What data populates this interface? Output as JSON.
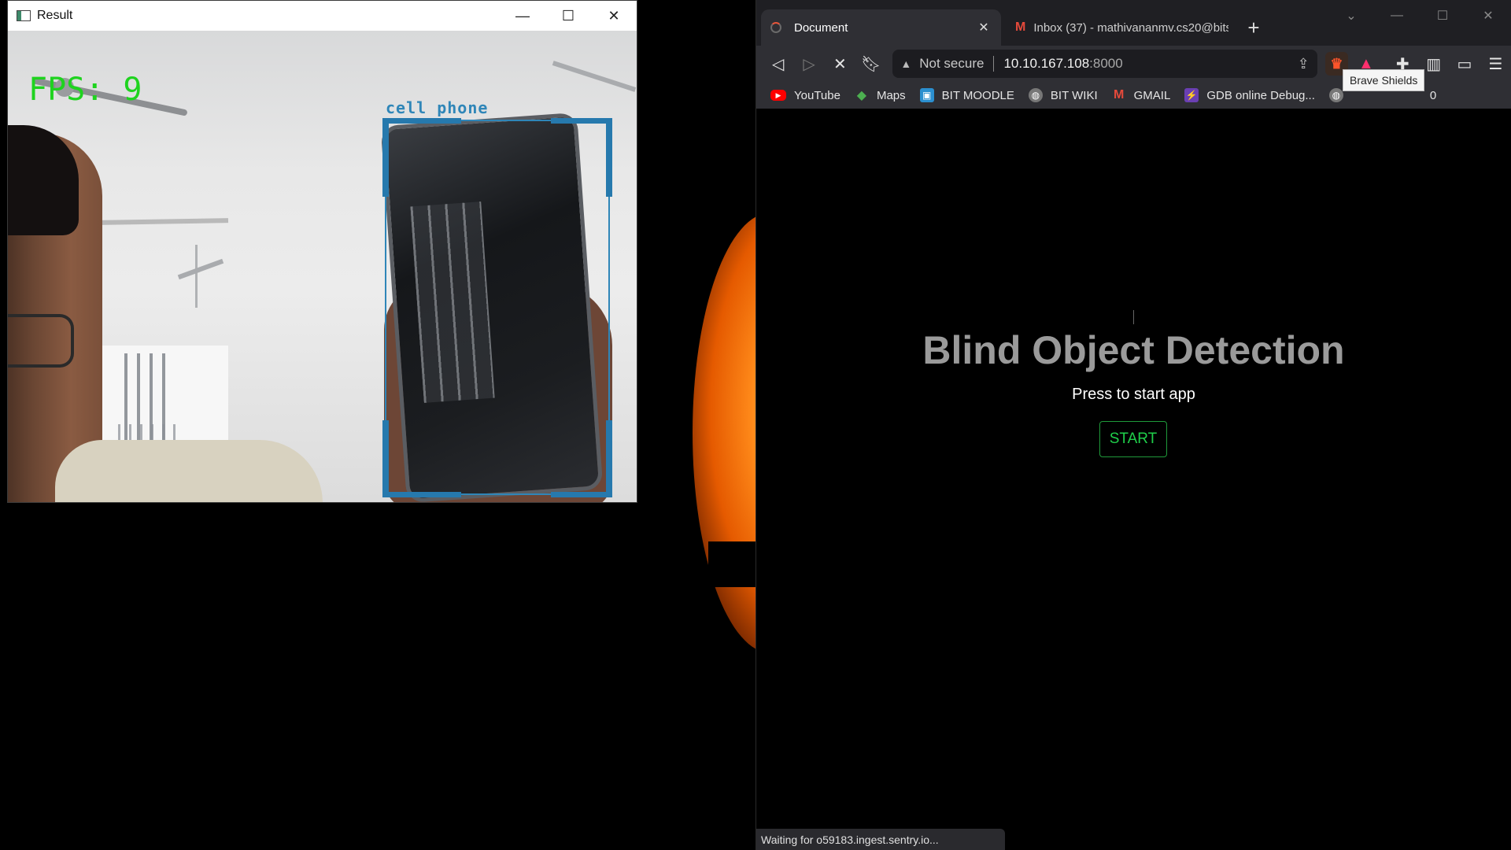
{
  "result_window": {
    "title": "Result",
    "controls": {
      "minimize": "—",
      "maximize": "☐",
      "close": "✕"
    },
    "fps_text": "FPS:  9",
    "detection_label": "cell phone",
    "detection_color": "#2f86b8",
    "fps_color": "#1fd31f"
  },
  "browser": {
    "tabs": [
      {
        "title": "Document",
        "active": true,
        "loading": true
      },
      {
        "title": "Inbox (37) - mathivananmv.cs20@bits",
        "active": false,
        "icon": "gmail-icon"
      }
    ],
    "new_tab": "+",
    "toolbar": {
      "security_text": "Not secure",
      "url_host": "10.10.167.108",
      "url_port": ":8000"
    },
    "tooltip": "Brave Shields",
    "bookmarks": [
      {
        "label": "YouTube",
        "icon": "youtube-icon"
      },
      {
        "label": "Maps",
        "icon": "maps-icon"
      },
      {
        "label": "BIT MOODLE",
        "icon": "moodle-icon"
      },
      {
        "label": "BIT WIKI",
        "icon": "globe-icon"
      },
      {
        "label": "GMAIL",
        "icon": "gmail-icon"
      },
      {
        "label": "GDB online Debug...",
        "icon": "gdb-icon"
      }
    ],
    "bookmark_overflow": "0",
    "page": {
      "title": "Blind Object Detection",
      "subtitle": "Press to start app",
      "start_button": "START"
    },
    "status_text": "Waiting for o59183.ingest.sentry.io..."
  },
  "colors": {
    "accent_green": "#1fcf4a",
    "brave_orange": "#fb542b"
  }
}
